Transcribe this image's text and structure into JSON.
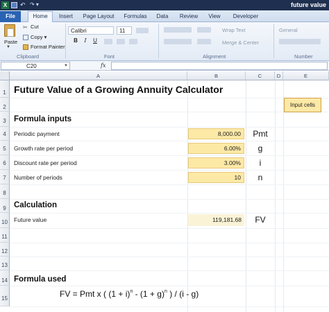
{
  "window": {
    "title": "future value",
    "app_logo": "X"
  },
  "ribbon": {
    "tabs": [
      "File",
      "Home",
      "Insert",
      "Page Layout",
      "Formulas",
      "Data",
      "Review",
      "View",
      "Developer"
    ],
    "clipboard": {
      "paste": "Paste",
      "cut": "Cut",
      "copy": "Copy",
      "copy_arrow": "▾",
      "format_painter": "Format Painter",
      "group_label": "Clipboard"
    },
    "font": {
      "name": "Calibri",
      "size": "11",
      "bold": "B",
      "italic": "I",
      "underline": "U",
      "group_label": "Font"
    },
    "alignment": {
      "wrap_text": "Wrap Text",
      "merge_center": "Merge & Center",
      "group_label": "Alignment"
    },
    "number": {
      "format": "General",
      "group_label": "Number"
    }
  },
  "formula_bar": {
    "name_box": "C20",
    "fx": "fx",
    "value": ""
  },
  "sheet": {
    "columns": [
      "A",
      "B",
      "C",
      "D",
      "E"
    ],
    "rows": [
      "1",
      "2",
      "3",
      "4",
      "5",
      "6",
      "7",
      "8",
      "9",
      "10",
      "11",
      "12",
      "13",
      "14",
      "15"
    ],
    "title": "Future Value of a Growing Annuity Calculator",
    "legend": "Input cells",
    "inputs_heading": "Formula inputs",
    "inputs": [
      {
        "label": "Periodic payment",
        "value": "8,000.00",
        "symbol": "Pmt"
      },
      {
        "label": "Growth rate per period",
        "value": "6.00%",
        "symbol": "g"
      },
      {
        "label": "Discount rate per period",
        "value": "3.00%",
        "symbol": "i"
      },
      {
        "label": "Number of periods",
        "value": "10",
        "symbol": "n"
      }
    ],
    "calc_heading": "Calculation",
    "calculation": {
      "label": "Future value",
      "value": "119,181.68",
      "symbol": "FV"
    },
    "formula_heading": "Formula used",
    "formula": {
      "part1": "FV = Pmt x ( (1 + i)",
      "exp1": "n",
      "part2": " - (1 + g)",
      "exp2": "n",
      "part3": " ) / (i - g)"
    }
  }
}
